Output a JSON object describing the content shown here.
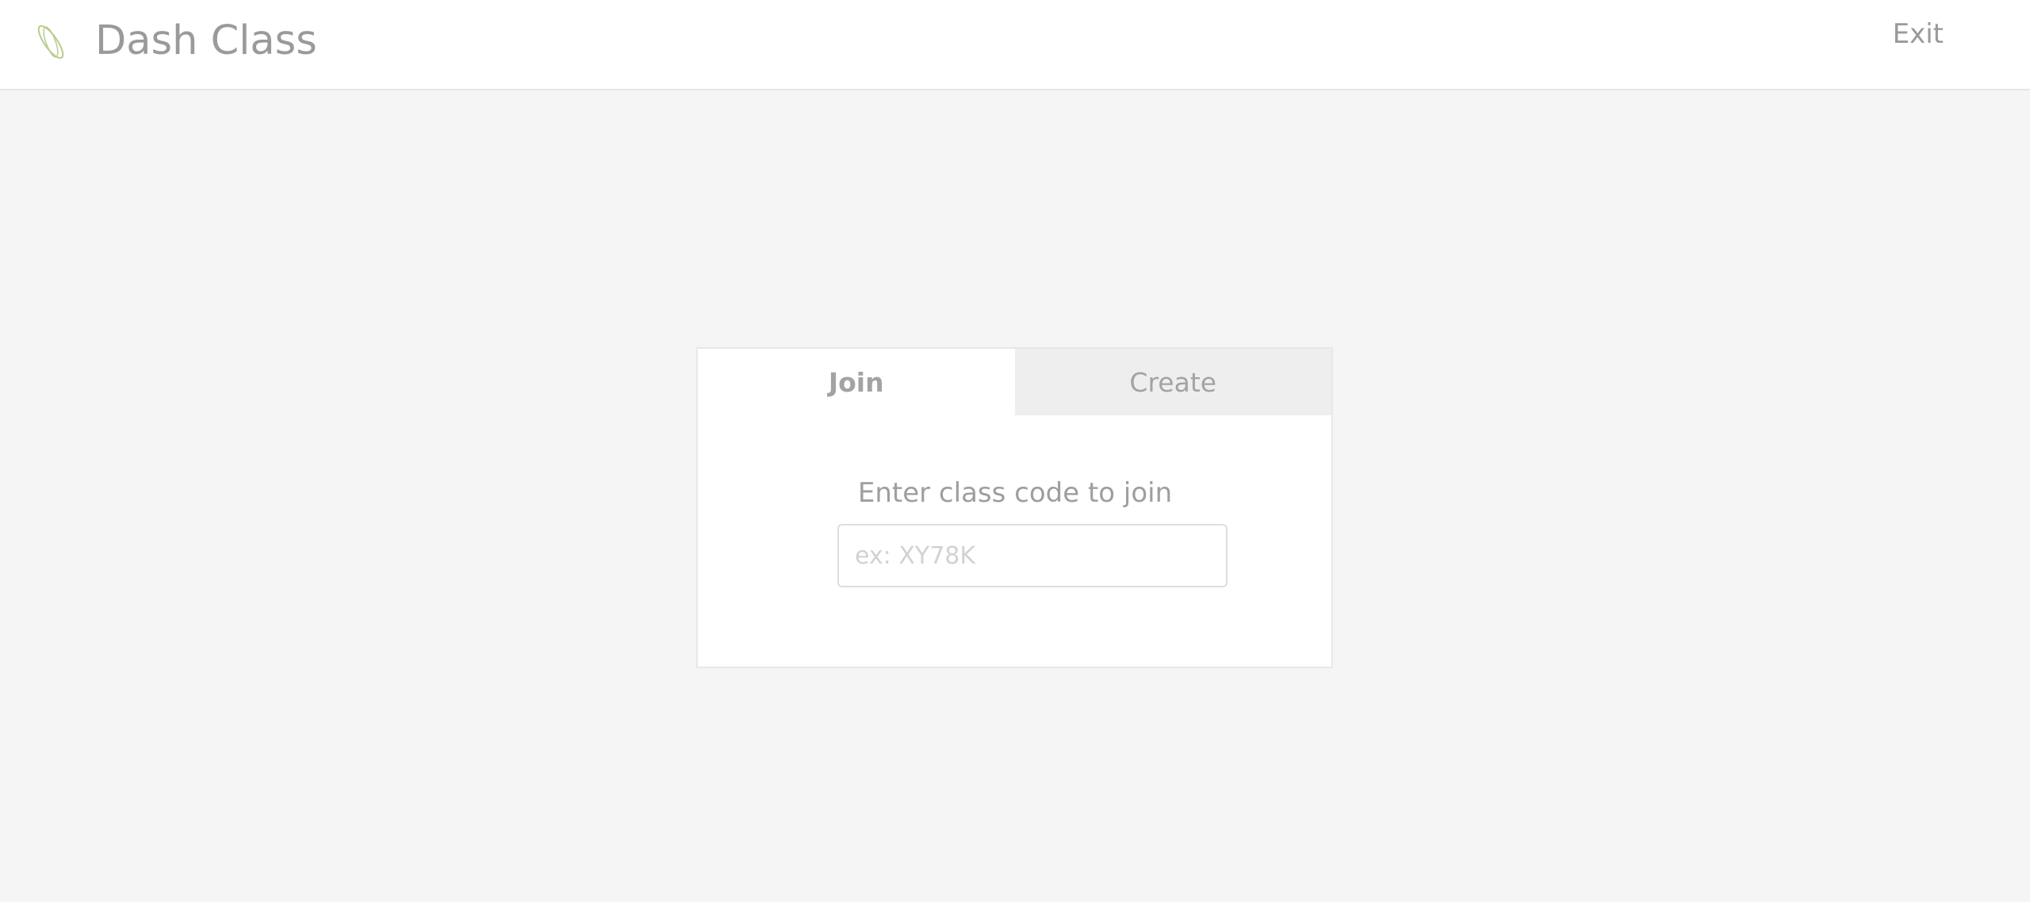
{
  "header": {
    "app_title": "Dash Class",
    "exit_label": "Exit",
    "logo_icon": "atom-orbit-icon",
    "logo_color": "#b8cc8c"
  },
  "card": {
    "tabs": [
      {
        "label": "Join",
        "active": true
      },
      {
        "label": "Create",
        "active": false
      }
    ],
    "prompt": "Enter class code to join",
    "code_input": {
      "value": "",
      "placeholder": "ex: XY78K"
    }
  },
  "colors": {
    "background": "#f5f5f5",
    "header_bg": "#ffffff",
    "text_muted": "#9a9a9a",
    "inactive_tab_bg": "#eeeeee"
  }
}
